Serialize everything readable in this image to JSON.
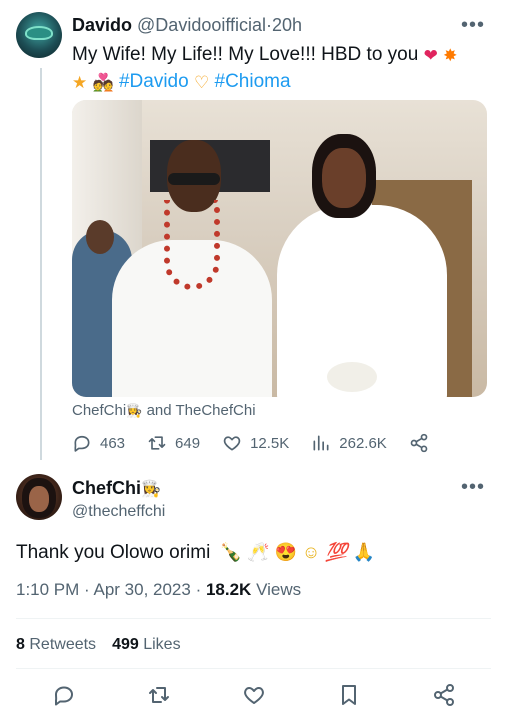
{
  "tweet1": {
    "name": "Davido",
    "handle": "@Davidooifficial",
    "time": "20h",
    "text": "My Wife! My Life!! My Love!!! HBD to you",
    "hashtags": [
      "#Davido",
      "#Chioma"
    ],
    "emojis": [
      "red-heart",
      "collision",
      "star",
      "couple-with-heart",
      "heart-hands"
    ],
    "tagged_text": "ChefChi",
    "tagged_and": "and TheChefChi",
    "replies": "463",
    "retweets": "649",
    "likes": "12.5K",
    "views": "262.6K"
  },
  "tweet2": {
    "name": "ChefChi",
    "handle": "@thecheffchi",
    "text": "Thank you Olowo orimi",
    "emojis": [
      "bottle-with-popping-cork",
      "clinking-glasses",
      "smiling-face-with-heart-eyes",
      "smiling-face",
      "hundred-points",
      "folded-hands"
    ],
    "time": "1:10 PM",
    "date": "Apr 30, 2023",
    "views_count": "18.2K",
    "views_label": "Views",
    "retweets_count": "8",
    "retweets_label": "Retweets",
    "likes_count": "499",
    "likes_label": "Likes"
  },
  "colors": {
    "link": "#1d9bf0",
    "secondary_text": "#536471",
    "primary_text": "#0f1419",
    "divider": "#eff3f4"
  }
}
